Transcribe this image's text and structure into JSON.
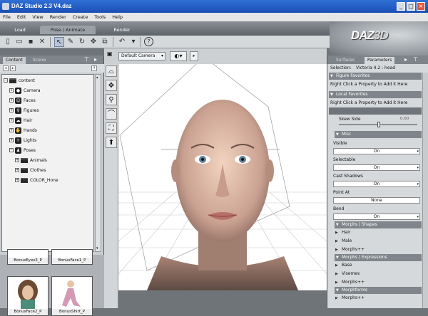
{
  "window": {
    "title": "DAZ Studio 2.3     V4.daz"
  },
  "menu": [
    "File",
    "Edit",
    "View",
    "Render",
    "Create",
    "Tools",
    "Help"
  ],
  "rooms": [
    "Load",
    "Pose / Animate",
    "Render"
  ],
  "logo": {
    "prefix": "DAZ",
    "suffix": "3D"
  },
  "left_panel": {
    "tabs": [
      "Content",
      "Scene"
    ],
    "tree": [
      {
        "label": "content",
        "level": 0
      },
      {
        "label": "Camera",
        "level": 1
      },
      {
        "label": "Faces",
        "level": 1
      },
      {
        "label": "Figures",
        "level": 1
      },
      {
        "label": "Hair",
        "level": 1
      },
      {
        "label": "Hands",
        "level": 1
      },
      {
        "label": "Lights",
        "level": 1
      },
      {
        "label": "Poses",
        "level": 1
      },
      {
        "label": "Animals",
        "level": 2
      },
      {
        "label": "Clothes",
        "level": 2
      },
      {
        "label": "COLOR_Hone",
        "level": 2
      }
    ],
    "thumbs": [
      "BonusEyes3_P",
      "BonusFace1_P",
      "BonusFace2_P",
      "BonusShirt_P"
    ],
    "thumbs_top": [
      "BonusEyes3_P",
      "BonusFace1_P"
    ]
  },
  "viewport": {
    "camera": "Default Camera"
  },
  "right_panel": {
    "tabs": [
      "Surfaces",
      "Parameters"
    ],
    "selection_label": "Selection:",
    "selection_value": "Victoria 4.2 : head",
    "figure_favorites": "Figure Favorites",
    "favorites_hint": "Right Click a Property to Add it Here",
    "local_favorites": "Local Favorites",
    "local_hint": "Right Click a Property to Add it Here",
    "slider_label": "Skew Side",
    "slider_value": "0.00",
    "misc": "Misc",
    "props": [
      {
        "label": "Visible",
        "value": "On"
      },
      {
        "label": "Selectable",
        "value": "On"
      },
      {
        "label": "Cast Shadows",
        "value": "On"
      },
      {
        "label": "Point At",
        "value": "None"
      },
      {
        "label": "Bend",
        "value": "On"
      }
    ],
    "groups": [
      {
        "title": "Morphs | Shapes",
        "items": [
          "Hair",
          "Male",
          "Morphs++"
        ]
      },
      {
        "title": "Morphs | Expressions",
        "items": [
          "Base",
          "Visemes",
          "Morphs++"
        ]
      },
      {
        "title": "Morphforms",
        "items": [
          "Morphs++"
        ]
      }
    ]
  },
  "colors": {
    "titlebar": "#1b4fb3",
    "panel": "#d6d9dc",
    "section": "#7f858a"
  }
}
